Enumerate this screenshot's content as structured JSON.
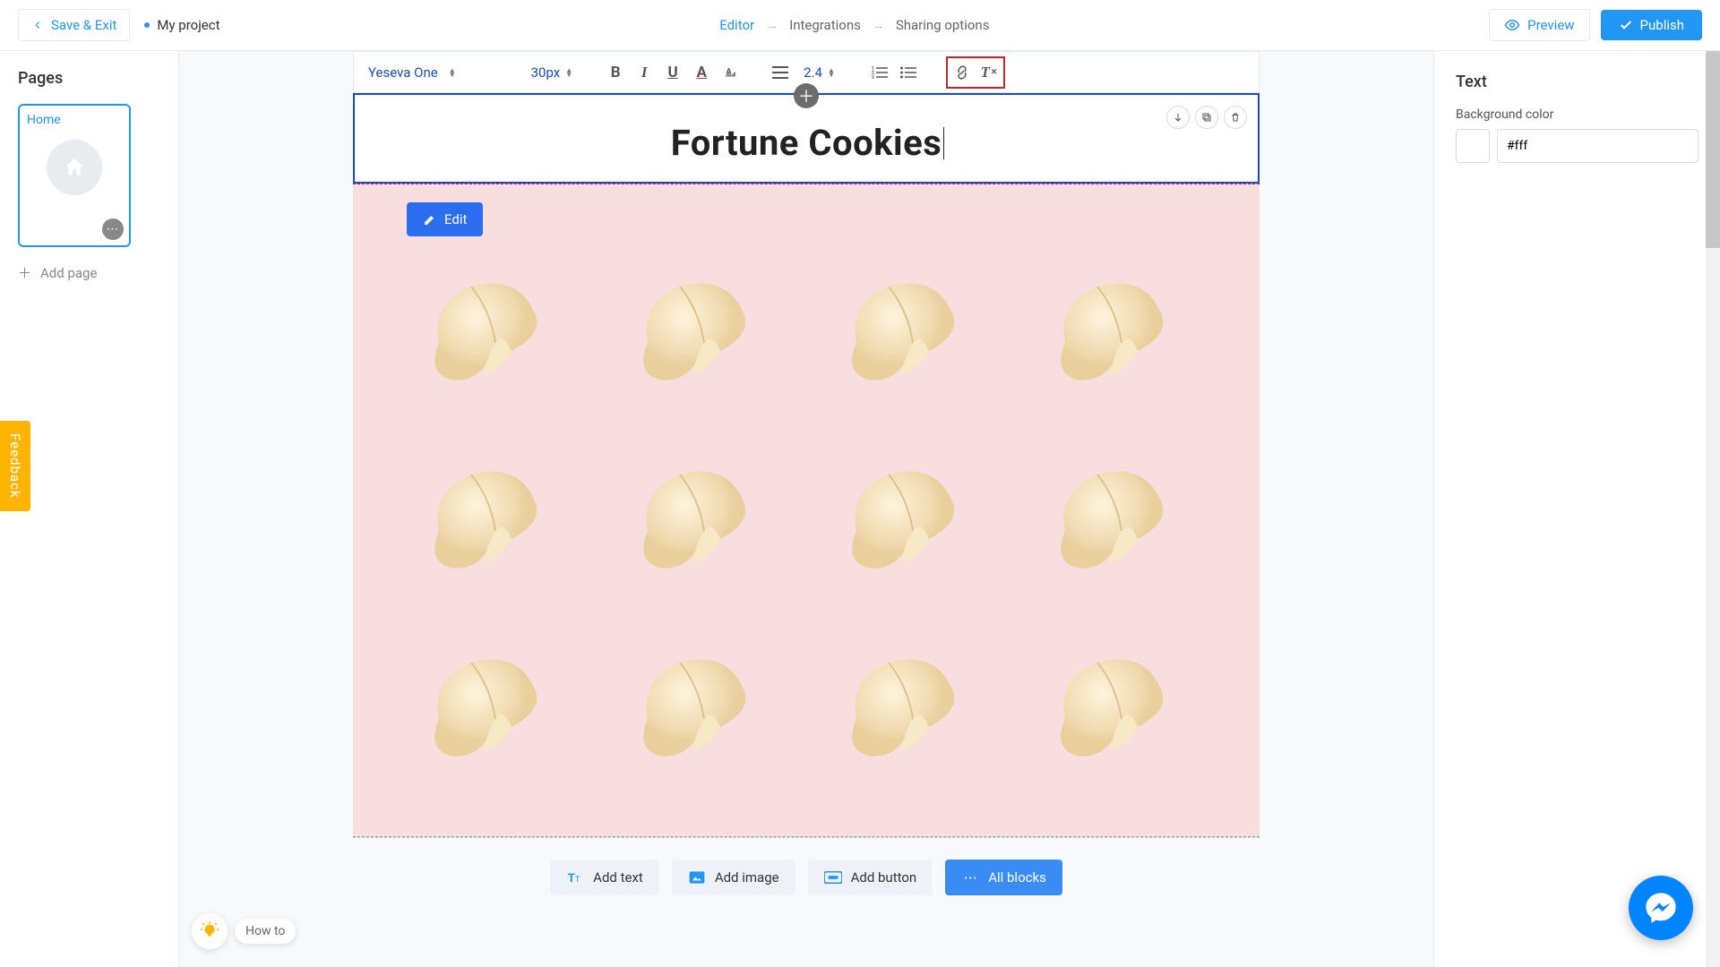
{
  "header": {
    "save_exit": "Save & Exit",
    "project_name": "My project",
    "breadcrumbs": {
      "editor": "Editor",
      "integrations": "Integrations",
      "sharing": "Sharing options"
    },
    "preview": "Preview",
    "publish": "Publish"
  },
  "left_panel": {
    "title": "Pages",
    "pages": [
      {
        "label": "Home"
      }
    ],
    "add_page": "Add page"
  },
  "toolbar": {
    "font_family": "Yeseva One",
    "font_size": "30px",
    "line_height": "2.4"
  },
  "canvas": {
    "title_text": "Fortune Cookies",
    "edit": "Edit"
  },
  "bottom_actions": {
    "add_text": "Add text",
    "add_image": "Add image",
    "add_button": "Add button",
    "all_blocks": "All blocks"
  },
  "right_panel": {
    "title": "Text",
    "bg_label": "Background color",
    "bg_value": "#fff"
  },
  "feedback": "Feedback",
  "howto": "How to"
}
